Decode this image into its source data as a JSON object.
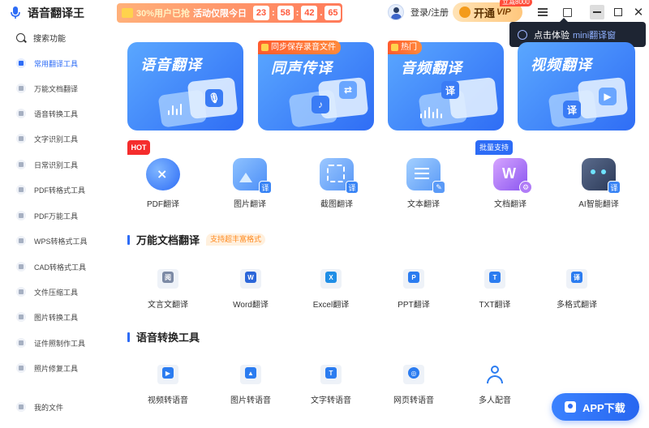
{
  "app": {
    "name": "语音翻译王",
    "login": "登录/注册",
    "vip_label": "开通",
    "vip_suffix": "VIP",
    "vip_tag": "立减8000"
  },
  "promo": {
    "text1": "30%用户已抢",
    "text2": "活动仅限今日",
    "countdown": [
      "23",
      "58",
      "42",
      "65"
    ]
  },
  "mini_tip": {
    "text": "点击体验",
    "highlight": "mini翻译窗"
  },
  "sidebar": {
    "search": "搜索功能",
    "items": [
      {
        "label": "常用翻译工具",
        "active": true
      },
      {
        "label": "万能文档翻译"
      },
      {
        "label": "语音转换工具"
      },
      {
        "label": "文字识别工具"
      },
      {
        "label": "日常识别工具"
      },
      {
        "label": "PDF转格式工具"
      },
      {
        "label": "PDF万能工具"
      },
      {
        "label": "WPS转格式工具"
      },
      {
        "label": "CAD转格式工具"
      },
      {
        "label": "文件压缩工具"
      },
      {
        "label": "图片转换工具"
      },
      {
        "label": "证件照制作工具"
      },
      {
        "label": "照片修复工具"
      }
    ],
    "my_files": "我的文件"
  },
  "banners": [
    {
      "title": "语音翻译"
    },
    {
      "title": "同声传译",
      "badge": "同步保存录音文件"
    },
    {
      "title": "音频翻译",
      "badge": "热门"
    },
    {
      "title": "视频翻译"
    }
  ],
  "tools": [
    {
      "label": "PDF翻译",
      "tag": "HOT"
    },
    {
      "label": "图片翻译"
    },
    {
      "label": "截图翻译"
    },
    {
      "label": "文本翻译"
    },
    {
      "label": "文档翻译",
      "tag": "批量支持"
    },
    {
      "label": "AI智能翻译"
    }
  ],
  "doc_section": {
    "title": "万能文档翻译",
    "tag": "支持超丰富格式",
    "items": [
      {
        "label": "文言文翻译",
        "glyph": "阅"
      },
      {
        "label": "Word翻译",
        "glyph": "W"
      },
      {
        "label": "Excel翻译",
        "glyph": "X"
      },
      {
        "label": "PPT翻译",
        "glyph": "P"
      },
      {
        "label": "TXT翻译",
        "glyph": "T"
      },
      {
        "label": "多格式翻译",
        "glyph": "译"
      }
    ]
  },
  "voice_section": {
    "title": "语音转换工具",
    "items": [
      {
        "label": "视频转语音"
      },
      {
        "label": "图片转语音"
      },
      {
        "label": "文字转语音"
      },
      {
        "label": "网页转语音"
      },
      {
        "label": "多人配音"
      }
    ]
  },
  "app_download": "APP下载",
  "colors": {
    "accent": "#2d6cf6",
    "promo": "#ff6b4a",
    "hot": "#f52c2c"
  }
}
